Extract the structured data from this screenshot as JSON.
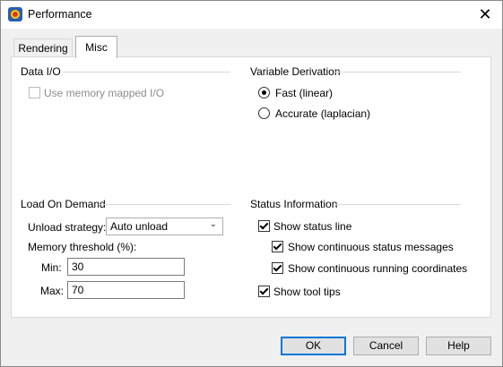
{
  "window": {
    "title": "Performance",
    "close_glyph": "✕",
    "app_icon": "tecplot-app-icon"
  },
  "tabs": [
    {
      "label": "Rendering",
      "active": false
    },
    {
      "label": "Misc",
      "active": true
    }
  ],
  "data_io": {
    "title": "Data I/O",
    "memory_mapped": {
      "label": "Use memory mapped I/O",
      "checked": false,
      "enabled": false
    }
  },
  "variable_derivation": {
    "title": "Variable Derivation",
    "options": [
      {
        "label": "Fast (linear)",
        "selected": true
      },
      {
        "label": "Accurate (laplacian)",
        "selected": false
      }
    ]
  },
  "load_on_demand": {
    "title": "Load On Demand",
    "unload_strategy_label": "Unload strategy:",
    "unload_strategy_value": "Auto unload",
    "memory_threshold_label": "Memory threshold (%):",
    "min_label": "Min:",
    "min_value": "30",
    "max_label": "Max:",
    "max_value": "70"
  },
  "status_information": {
    "title": "Status Information",
    "show_status_line": {
      "label": "Show status line",
      "checked": true
    },
    "show_continuous_status_messages": {
      "label": "Show continuous status messages",
      "checked": true
    },
    "show_continuous_running_coordinates": {
      "label": "Show continuous running coordinates",
      "checked": true
    },
    "show_tool_tips": {
      "label": "Show tool tips",
      "checked": true
    }
  },
  "buttons": {
    "ok": "OK",
    "cancel": "Cancel",
    "help": "Help"
  },
  "colors": {
    "accent": "#0078d7",
    "background": "#f0f0f0",
    "panel": "#ffffff"
  }
}
